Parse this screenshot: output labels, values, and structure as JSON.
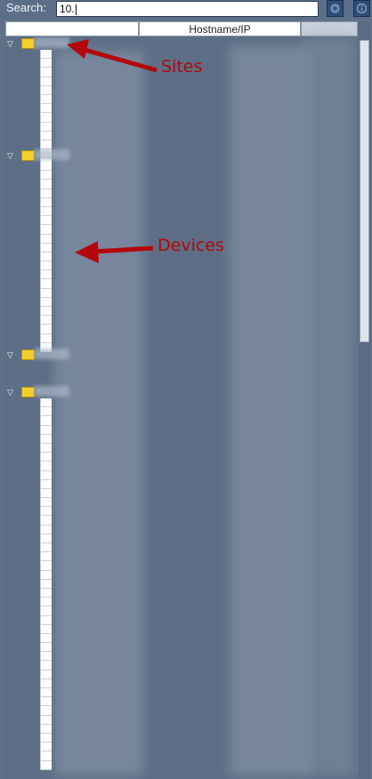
{
  "search": {
    "label": "Search:",
    "value": "10."
  },
  "toolbar": {
    "settings_icon": "gear-icon",
    "info_icon": "info-icon"
  },
  "columns": {
    "name": "",
    "hostname": "Hostname/IP",
    "extra": ""
  },
  "annotations": {
    "sites": "Sites",
    "devices": "Devices",
    "color": "#b3070b"
  },
  "tree": {
    "sites": [
      {
        "label": "",
        "expanded": true,
        "device_rows": 13
      },
      {
        "label": "",
        "expanded": true,
        "device_rows": 21
      },
      {
        "label": "",
        "expanded": true,
        "device_rows": 0
      },
      {
        "label": "",
        "expanded": true,
        "device_rows": 41
      }
    ]
  }
}
